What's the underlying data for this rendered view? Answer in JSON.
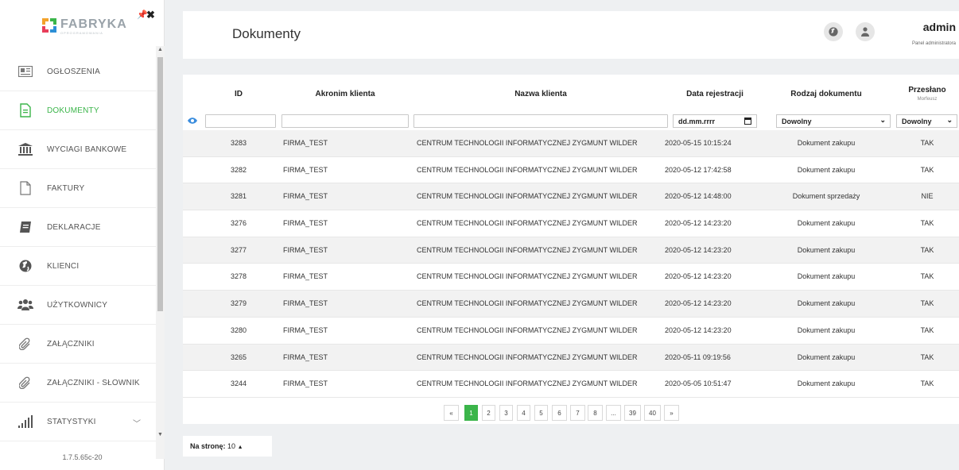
{
  "sidebar": {
    "logo_text": "FABRYKA",
    "logo_sub": "OPROGRAMOWANIA",
    "version": "1.7.5.65c-20",
    "items": [
      {
        "label": "OGŁOSZENIA",
        "icon": "newspaper-icon"
      },
      {
        "label": "DOKUMENTY",
        "icon": "document-icon"
      },
      {
        "label": "WYCIAGI BANKOWE",
        "icon": "bank-icon"
      },
      {
        "label": "FAKTURY",
        "icon": "file-icon"
      },
      {
        "label": "DEKLARACJE",
        "icon": "notebook-icon"
      },
      {
        "label": "KLIENCI",
        "icon": "globe-icon"
      },
      {
        "label": "UŻYTKOWNICY",
        "icon": "users-icon"
      },
      {
        "label": "ZAŁĄCZNIKI",
        "icon": "paperclip-icon"
      },
      {
        "label": "ZAŁĄCZNIKI - SŁOWNIK",
        "icon": "paperclip-icon"
      },
      {
        "label": "STATYSTYKI",
        "icon": "bar-chart-icon"
      }
    ],
    "active_color": "#3bb54a"
  },
  "header": {
    "title": "Dokumenty",
    "user_name": "admin",
    "user_role": "Panel administratora"
  },
  "table": {
    "columns": {
      "id": "ID",
      "acronym": "Akronim klienta",
      "client": "Nazwa klienta",
      "date": "Data rejestracji",
      "type": "Rodzaj dokumentu",
      "sent": "Przesłano",
      "sent_sub": "Morfeusz"
    },
    "filters": {
      "date_placeholder": "dd.mm.rrrr",
      "type_selected": "Dowolny",
      "sent_selected": "Dowolny"
    },
    "rows": [
      {
        "id": "3283",
        "acronym": "FIRMA_TEST",
        "client": "CENTRUM TECHNOLOGII INFORMATYCZNEJ ZYGMUNT WILDER",
        "date": "2020-05-15 10:15:24",
        "type": "Dokument zakupu",
        "sent": "TAK"
      },
      {
        "id": "3282",
        "acronym": "FIRMA_TEST",
        "client": "CENTRUM TECHNOLOGII INFORMATYCZNEJ ZYGMUNT WILDER",
        "date": "2020-05-12 17:42:58",
        "type": "Dokument zakupu",
        "sent": "TAK"
      },
      {
        "id": "3281",
        "acronym": "FIRMA_TEST",
        "client": "CENTRUM TECHNOLOGII INFORMATYCZNEJ ZYGMUNT WILDER",
        "date": "2020-05-12 14:48:00",
        "type": "Dokument sprzedaży",
        "sent": "NIE"
      },
      {
        "id": "3276",
        "acronym": "FIRMA_TEST",
        "client": "CENTRUM TECHNOLOGII INFORMATYCZNEJ ZYGMUNT WILDER",
        "date": "2020-05-12 14:23:20",
        "type": "Dokument zakupu",
        "sent": "TAK"
      },
      {
        "id": "3277",
        "acronym": "FIRMA_TEST",
        "client": "CENTRUM TECHNOLOGII INFORMATYCZNEJ ZYGMUNT WILDER",
        "date": "2020-05-12 14:23:20",
        "type": "Dokument zakupu",
        "sent": "TAK"
      },
      {
        "id": "3278",
        "acronym": "FIRMA_TEST",
        "client": "CENTRUM TECHNOLOGII INFORMATYCZNEJ ZYGMUNT WILDER",
        "date": "2020-05-12 14:23:20",
        "type": "Dokument zakupu",
        "sent": "TAK"
      },
      {
        "id": "3279",
        "acronym": "FIRMA_TEST",
        "client": "CENTRUM TECHNOLOGII INFORMATYCZNEJ ZYGMUNT WILDER",
        "date": "2020-05-12 14:23:20",
        "type": "Dokument zakupu",
        "sent": "TAK"
      },
      {
        "id": "3280",
        "acronym": "FIRMA_TEST",
        "client": "CENTRUM TECHNOLOGII INFORMATYCZNEJ ZYGMUNT WILDER",
        "date": "2020-05-12 14:23:20",
        "type": "Dokument zakupu",
        "sent": "TAK"
      },
      {
        "id": "3265",
        "acronym": "FIRMA_TEST",
        "client": "CENTRUM TECHNOLOGII INFORMATYCZNEJ ZYGMUNT WILDER",
        "date": "2020-05-11 09:19:56",
        "type": "Dokument zakupu",
        "sent": "TAK"
      },
      {
        "id": "3244",
        "acronym": "FIRMA_TEST",
        "client": "CENTRUM TECHNOLOGII INFORMATYCZNEJ ZYGMUNT WILDER",
        "date": "2020-05-05 10:51:47",
        "type": "Dokument zakupu",
        "sent": "TAK"
      }
    ]
  },
  "pagination": {
    "prev": "«",
    "next": "»",
    "pages": [
      "1",
      "2",
      "3",
      "4",
      "5",
      "6",
      "7",
      "8",
      "...",
      "39",
      "40"
    ],
    "current": "1"
  },
  "per_page": {
    "label": "Na stronę:",
    "value": "10"
  }
}
